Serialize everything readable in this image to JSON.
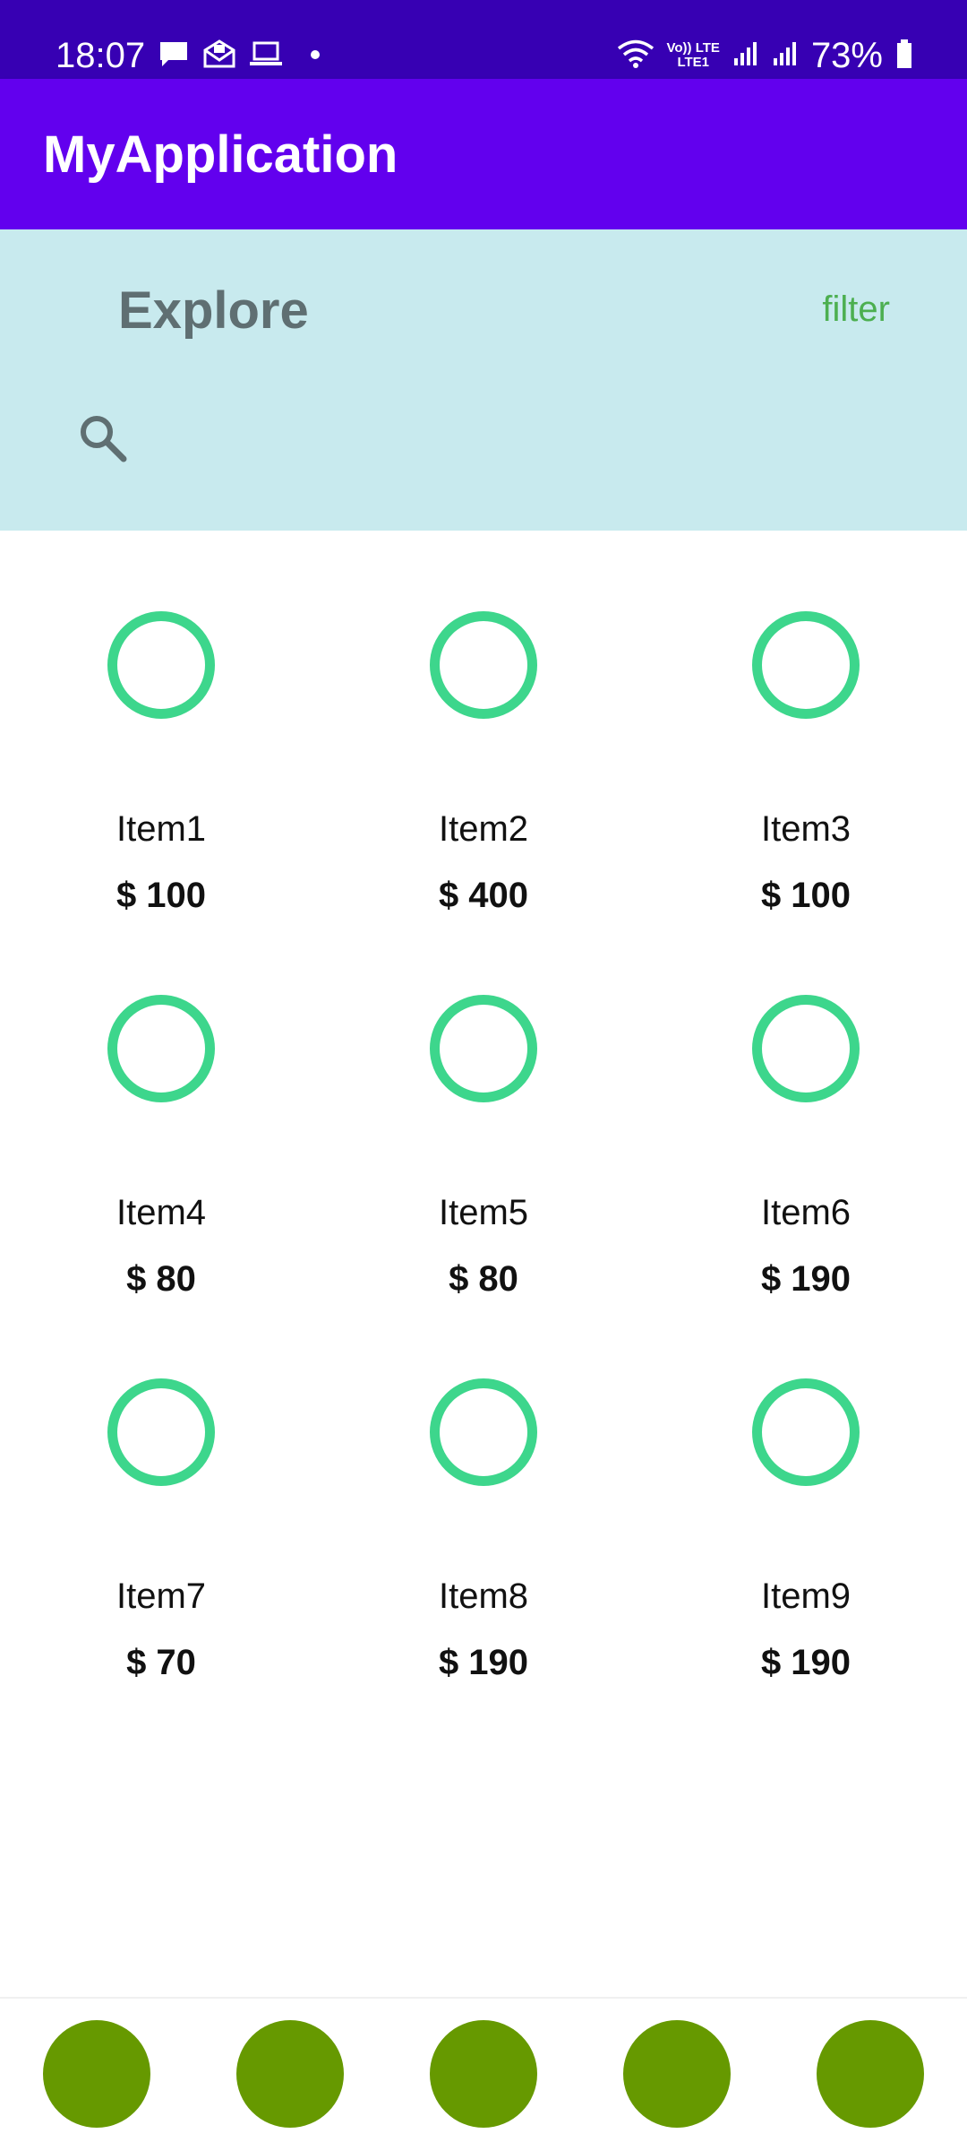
{
  "status_bar": {
    "time": "18:07",
    "battery": "73%",
    "network_top": "Vo)) LTE",
    "network_bottom": "LTE1",
    "icons": [
      "chat-icon",
      "mail-icon",
      "laptop-icon",
      "dot-icon",
      "wifi-icon",
      "signal-icon",
      "signal-icon",
      "battery-icon"
    ]
  },
  "app_bar": {
    "title": "MyApplication"
  },
  "explore": {
    "title": "Explore",
    "filter_label": "filter",
    "search_icon": "search-icon"
  },
  "items": [
    {
      "name": "Item1",
      "price": "$ 100"
    },
    {
      "name": "Item2",
      "price": "$ 400"
    },
    {
      "name": "Item3",
      "price": "$ 100"
    },
    {
      "name": "Item4",
      "price": "$ 80"
    },
    {
      "name": "Item5",
      "price": "$ 80"
    },
    {
      "name": "Item6",
      "price": "$ 190"
    },
    {
      "name": "Item7",
      "price": "$ 70"
    },
    {
      "name": "Item8",
      "price": "$ 190"
    },
    {
      "name": "Item9",
      "price": "$ 190"
    }
  ],
  "bottom_nav": {
    "count": 5
  },
  "colors": {
    "status_bar": "#3700b3",
    "app_bar": "#6200ee",
    "explore_bg": "#c8eaee",
    "accent_green": "#4caf50",
    "ring_green": "#3dd68c",
    "nav_green": "#669900"
  }
}
